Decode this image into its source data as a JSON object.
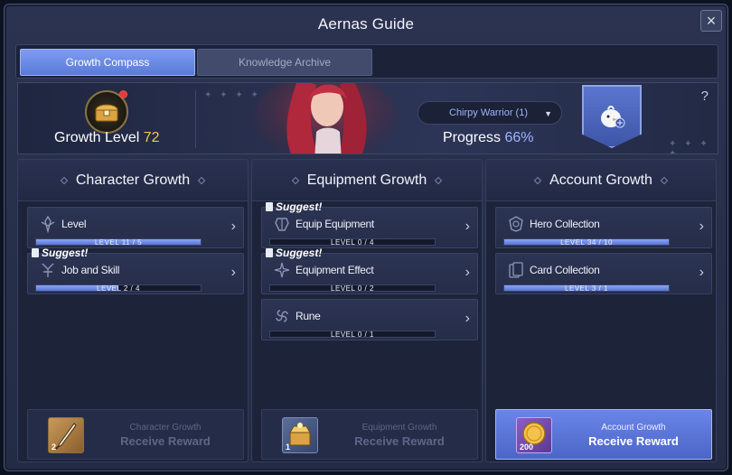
{
  "window": {
    "title": "Aernas Guide",
    "close_icon": "×"
  },
  "tabs": [
    {
      "label": "Growth Compass",
      "active": true
    },
    {
      "label": "Knowledge Archive",
      "active": false
    }
  ],
  "banner": {
    "growth_level_label": "Growth Level",
    "growth_level_value": "72",
    "selector_value": "Chirpy Warrior (1)",
    "progress_label": "Progress",
    "progress_value": "66%",
    "help": "?"
  },
  "columns": [
    {
      "title": "Character Growth",
      "items": [
        {
          "label": "Level",
          "level_text": "LEVEL 11 / 5",
          "progress": 1.0,
          "suggest": false,
          "icon": "level-icon"
        },
        {
          "label": "Job and Skill",
          "level_text": "LEVEL 2 / 4",
          "progress": 0.5,
          "suggest": true,
          "icon": "job-skill-icon"
        }
      ],
      "reward": {
        "line1": "Character Growth",
        "line2": "Receive Reward",
        "qty": "2",
        "active": false,
        "icon": "quill-icon"
      }
    },
    {
      "title": "Equipment Growth",
      "items": [
        {
          "label": "Equip Equipment",
          "level_text": "LEVEL 0 / 4",
          "progress": 0.0,
          "suggest": true,
          "icon": "equip-icon"
        },
        {
          "label": "Equipment Effect",
          "level_text": "LEVEL 0 / 2",
          "progress": 0.0,
          "suggest": true,
          "icon": "effect-icon"
        },
        {
          "label": "Rune",
          "level_text": "LEVEL 0 / 1",
          "progress": 0.0,
          "suggest": false,
          "icon": "rune-icon"
        }
      ],
      "reward": {
        "line1": "Equipment Growth",
        "line2": "Receive Reward",
        "qty": "1",
        "active": false,
        "icon": "treasure-box-icon"
      }
    },
    {
      "title": "Account Growth",
      "items": [
        {
          "label": "Hero Collection",
          "level_text": "LEVEL 34 / 10",
          "progress": 1.0,
          "suggest": false,
          "icon": "hero-collection-icon"
        },
        {
          "label": "Card Collection",
          "level_text": "LEVEL 3 / 1",
          "progress": 1.0,
          "suggest": false,
          "icon": "card-collection-icon"
        }
      ],
      "reward": {
        "line1": "Account Growth",
        "line2": "Receive Reward",
        "qty": "200",
        "active": true,
        "icon": "gold-coin-icon"
      }
    }
  ],
  "suggest_label": "Suggest!",
  "chevron": "›",
  "caret": "▼",
  "stars": "✦ ✦ ✦ ✦"
}
